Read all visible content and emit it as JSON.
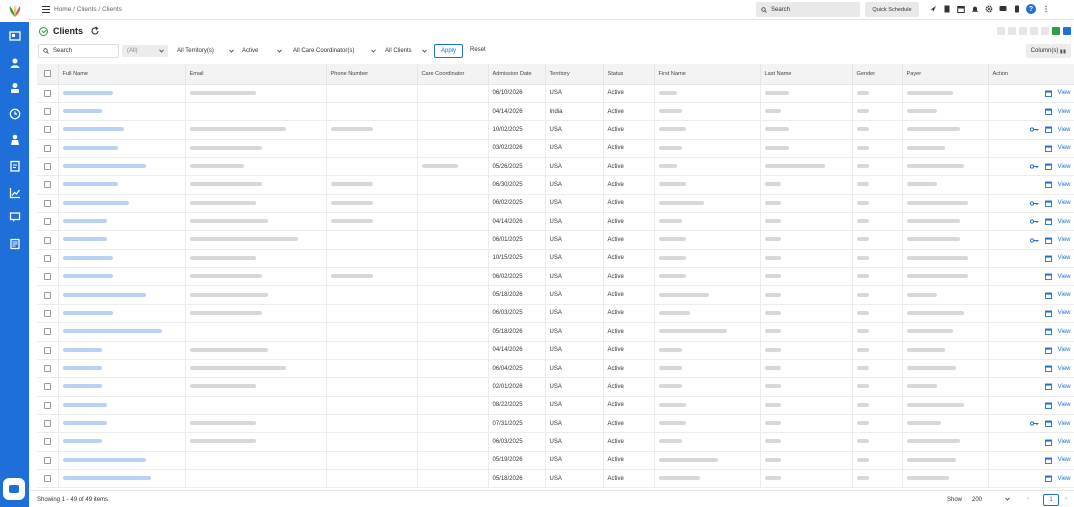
{
  "breadcrumb": "Home / Clients / Clients",
  "topbar": {
    "search_label": "Search",
    "quick_schedule": "Quick Schedule",
    "help_label": "?"
  },
  "page": {
    "title": "Clients"
  },
  "filters": {
    "search_label": "Search",
    "blank_value": "(All)",
    "territory": "All Territory(s)",
    "status": "Active",
    "care_coordinator": "All Care Coordinator(s)",
    "clients": "All Clients",
    "apply": "Apply",
    "reset": "Reset",
    "columns": "Column(s)"
  },
  "table": {
    "headers": {
      "full_name": "Full Name",
      "email": "Email",
      "phone": "Phone Number",
      "care_coordinator": "Care Coordinator",
      "admission_date": "Admission Date",
      "territory": "Territory",
      "status": "Status",
      "first_name": "First Name",
      "last_name": "Last Name",
      "gender": "Gender",
      "payer": "Payer",
      "action": "Action"
    },
    "view_label": "View",
    "rows": [
      {
        "admission_date": "06/10/2026",
        "territory": "USA",
        "status": "Active",
        "n": 0.45,
        "e": 0.55,
        "p": 0,
        "c": 0,
        "f": 0.2,
        "l": 0.3,
        "g": 0.3,
        "y": 0.6,
        "key": false
      },
      {
        "admission_date": "04/14/2026",
        "territory": "India",
        "status": "Active",
        "n": 0.35,
        "e": 0.0,
        "p": 0,
        "c": 0,
        "f": 0.25,
        "l": 0.2,
        "g": 0.3,
        "y": 0.4,
        "key": false
      },
      {
        "admission_date": "10/02/2025",
        "territory": "USA",
        "status": "Active",
        "n": 0.55,
        "e": 0.8,
        "p": 0.6,
        "c": 0,
        "f": 0.3,
        "l": 0.3,
        "g": 0.3,
        "y": 0.7,
        "key": true
      },
      {
        "admission_date": "03/02/2026",
        "territory": "USA",
        "status": "Active",
        "n": 0.5,
        "e": 0.6,
        "p": 0,
        "c": 0,
        "f": 0.25,
        "l": 0.3,
        "g": 0.3,
        "y": 0.5,
        "key": false
      },
      {
        "admission_date": "05/26/2025",
        "territory": "USA",
        "status": "Active",
        "n": 0.75,
        "e": 0.45,
        "p": 0,
        "c": 0.6,
        "f": 0.2,
        "l": 0.75,
        "g": 0.3,
        "y": 0.75,
        "key": true
      },
      {
        "admission_date": "06/30/2025",
        "territory": "USA",
        "status": "Active",
        "n": 0.5,
        "e": 0.6,
        "p": 0.6,
        "c": 0,
        "f": 0.3,
        "l": 0.2,
        "g": 0.3,
        "y": 0.4,
        "key": false
      },
      {
        "admission_date": "06/02/2025",
        "territory": "USA",
        "status": "Active",
        "n": 0.6,
        "e": 0.55,
        "p": 0.6,
        "c": 0,
        "f": 0.5,
        "l": 0.2,
        "g": 0.3,
        "y": 0.8,
        "key": true
      },
      {
        "admission_date": "04/14/2026",
        "territory": "USA",
        "status": "Active",
        "n": 0.4,
        "e": 0.65,
        "p": 0.6,
        "c": 0,
        "f": 0.25,
        "l": 0.2,
        "g": 0.3,
        "y": 0.7,
        "key": true
      },
      {
        "admission_date": "06/01/2025",
        "territory": "USA",
        "status": "Active",
        "n": 0.4,
        "e": 0.9,
        "p": 0,
        "c": 0,
        "f": 0.3,
        "l": 0.2,
        "g": 0.3,
        "y": 0.7,
        "key": true
      },
      {
        "admission_date": "10/15/2025",
        "territory": "USA",
        "status": "Active",
        "n": 0.45,
        "e": 0.55,
        "p": 0,
        "c": 0,
        "f": 0.3,
        "l": 0.2,
        "g": 0.3,
        "y": 0.8,
        "key": false
      },
      {
        "admission_date": "06/02/2025",
        "territory": "USA",
        "status": "Active",
        "n": 0.45,
        "e": 0.6,
        "p": 0.6,
        "c": 0,
        "f": 0.3,
        "l": 0.2,
        "g": 0.3,
        "y": 0.8,
        "key": false
      },
      {
        "admission_date": "05/18/2026",
        "territory": "USA",
        "status": "Active",
        "n": 0.75,
        "e": 0.65,
        "p": 0,
        "c": 0,
        "f": 0.55,
        "l": 0.2,
        "g": 0.3,
        "y": 0.4,
        "key": false
      },
      {
        "admission_date": "06/03/2025",
        "territory": "USA",
        "status": "Active",
        "n": 0.45,
        "e": 0.6,
        "p": 0,
        "c": 0,
        "f": 0.35,
        "l": 0.2,
        "g": 0.3,
        "y": 0.75,
        "key": false
      },
      {
        "admission_date": "05/18/2026",
        "territory": "USA",
        "status": "Active",
        "n": 0.9,
        "e": 0.0,
        "p": 0,
        "c": 0,
        "f": 0.75,
        "l": 0.2,
        "g": 0.3,
        "y": 0.6,
        "key": false
      },
      {
        "admission_date": "04/14/2026",
        "territory": "USA",
        "status": "Active",
        "n": 0.35,
        "e": 0.65,
        "p": 0,
        "c": 0,
        "f": 0.25,
        "l": 0.2,
        "g": 0.3,
        "y": 0.5,
        "key": false
      },
      {
        "admission_date": "06/04/2025",
        "territory": "USA",
        "status": "Active",
        "n": 0.35,
        "e": 0.8,
        "p": 0,
        "c": 0,
        "f": 0.25,
        "l": 0.2,
        "g": 0.3,
        "y": 0.65,
        "key": false
      },
      {
        "admission_date": "02/01/2026",
        "territory": "USA",
        "status": "Active",
        "n": 0.35,
        "e": 0.55,
        "p": 0,
        "c": 0,
        "f": 0.25,
        "l": 0.2,
        "g": 0.3,
        "y": 0.4,
        "key": false
      },
      {
        "admission_date": "08/22/2025",
        "territory": "USA",
        "status": "Active",
        "n": 0.4,
        "e": 0.0,
        "p": 0,
        "c": 0,
        "f": 0.3,
        "l": 0.2,
        "g": 0.3,
        "y": 0.75,
        "key": false
      },
      {
        "admission_date": "07/31/2025",
        "territory": "USA",
        "status": "Active",
        "n": 0.4,
        "e": 0.55,
        "p": 0,
        "c": 0,
        "f": 0.3,
        "l": 0.2,
        "g": 0.3,
        "y": 0.45,
        "key": true
      },
      {
        "admission_date": "06/03/2025",
        "territory": "USA",
        "status": "Active",
        "n": 0.35,
        "e": 0.55,
        "p": 0,
        "c": 0,
        "f": 0.25,
        "l": 0.2,
        "g": 0.3,
        "y": 0.7,
        "key": false
      },
      {
        "admission_date": "05/19/2026",
        "territory": "USA",
        "status": "Active",
        "n": 0.75,
        "e": 0.0,
        "p": 0,
        "c": 0,
        "f": 0.65,
        "l": 0.2,
        "g": 0.3,
        "y": 0.65,
        "key": false
      },
      {
        "admission_date": "05/18/2026",
        "territory": "USA",
        "status": "Active",
        "n": 0.8,
        "e": 0.0,
        "p": 0,
        "c": 0,
        "f": 0.45,
        "l": 0.2,
        "g": 0.3,
        "y": 0.55,
        "key": false
      },
      {
        "admission_date": "",
        "territory": "",
        "status": "",
        "n": 0.45,
        "e": 0.0,
        "p": 0,
        "c": 0,
        "f": 0.3,
        "l": 0.2,
        "g": 0.3,
        "y": 0.55,
        "key": false
      }
    ]
  },
  "footer": {
    "showing": "Showing 1 - 49 of 49 items",
    "show_label": "Show",
    "per_page": "200",
    "prev": "‹",
    "page": "1",
    "next": "›"
  },
  "colors": {
    "brand": "#1e6fd9",
    "success": "#2f9e44"
  }
}
